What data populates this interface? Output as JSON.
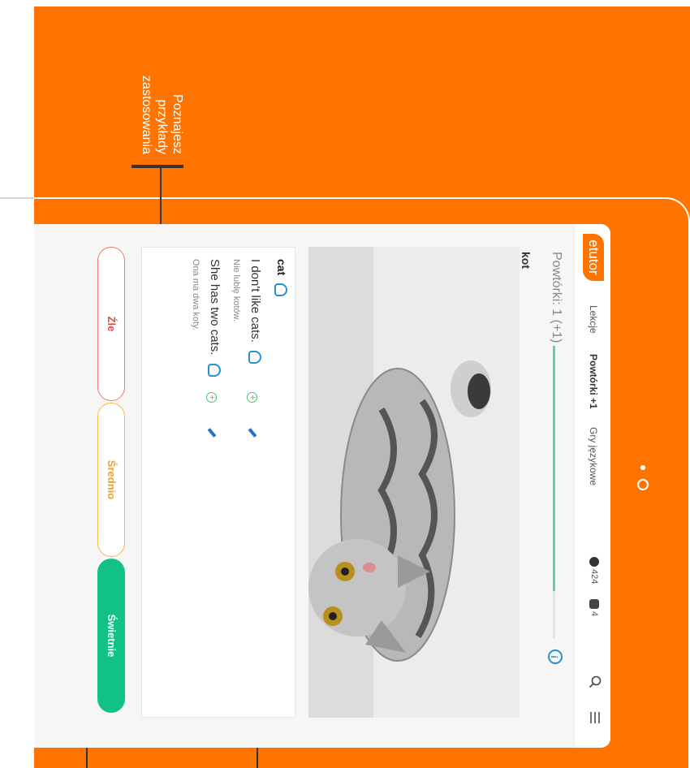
{
  "callout": {
    "text": "Poznajesz\nprzykłady\nzastosowania"
  },
  "header": {
    "logo": "etutor",
    "nav": [
      {
        "label": "Lekcje"
      },
      {
        "label": "Powtórki +1"
      },
      {
        "label": "Gry językowe"
      }
    ],
    "points": "424",
    "streak": "4"
  },
  "progress": {
    "label": "Powtórki: 1 (+1)",
    "fraction": 0.84
  },
  "word": "kot",
  "examples": {
    "word": "cat",
    "items": [
      {
        "sentence": "I don't like cats.",
        "translation": "Nie lubię kotów."
      },
      {
        "sentence": "She has two cats.",
        "translation": "Ona ma dwa koty."
      }
    ]
  },
  "buttons": {
    "bad": "Źle",
    "medium": "Średnio",
    "great": "Świetnie"
  },
  "colors": {
    "brand": "#ff7300",
    "great": "#11c185",
    "medium": "#f0a12a",
    "bad": "#e8473b",
    "accent": "#2a8fcf"
  }
}
